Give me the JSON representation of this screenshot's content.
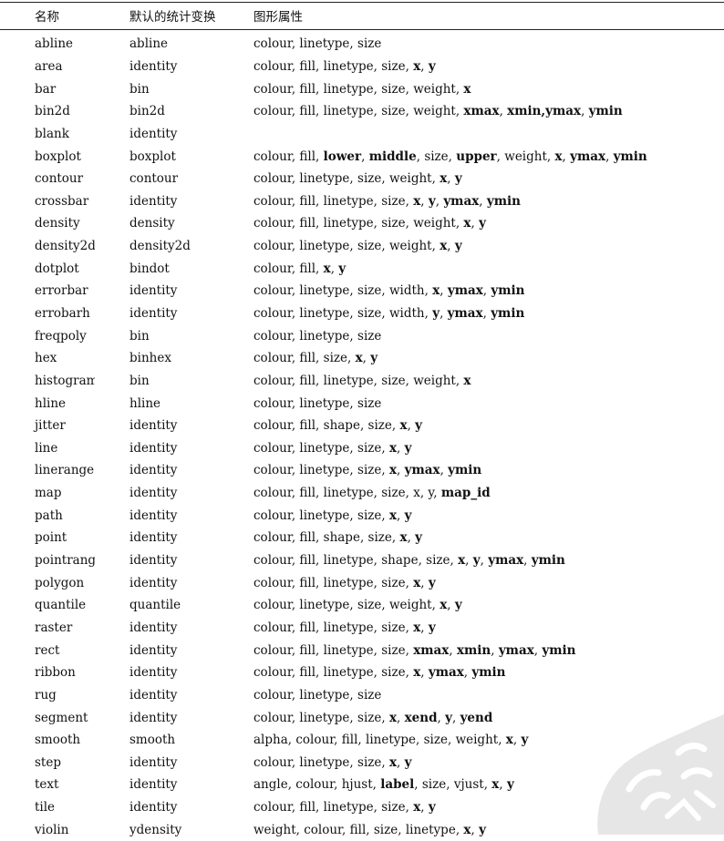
{
  "headers": {
    "name": "名称",
    "stat": "默认的统计变换",
    "aes": "图形属性"
  },
  "rows": [
    {
      "name": "abline",
      "stat": "abline",
      "aes": [
        {
          "t": "colour",
          "b": false
        },
        {
          "t": "linetype",
          "b": false
        },
        {
          "t": "size",
          "b": false
        }
      ]
    },
    {
      "name": "area",
      "stat": "identity",
      "aes": [
        {
          "t": "colour",
          "b": false
        },
        {
          "t": "fill",
          "b": false
        },
        {
          "t": "linetype",
          "b": false
        },
        {
          "t": "size",
          "b": false
        },
        {
          "t": "x",
          "b": true
        },
        {
          "t": "y",
          "b": true
        }
      ]
    },
    {
      "name": "bar",
      "stat": "bin",
      "aes": [
        {
          "t": "colour",
          "b": false
        },
        {
          "t": "fill",
          "b": false
        },
        {
          "t": "linetype",
          "b": false
        },
        {
          "t": "size",
          "b": false
        },
        {
          "t": "weight",
          "b": false
        },
        {
          "t": "x",
          "b": true
        }
      ]
    },
    {
      "name": "bin2d",
      "stat": "bin2d",
      "aes": [
        {
          "t": "colour",
          "b": false
        },
        {
          "t": "fill",
          "b": false
        },
        {
          "t": "linetype",
          "b": false
        },
        {
          "t": "size",
          "b": false
        },
        {
          "t": "weight",
          "b": false
        },
        {
          "t": "xmax",
          "b": true
        },
        {
          "t": "xmin,ymax",
          "b": true
        },
        {
          "t": "ymin",
          "b": true
        }
      ]
    },
    {
      "name": "blank",
      "stat": "identity",
      "aes": []
    },
    {
      "name": "boxplot",
      "stat": "boxplot",
      "aes": [
        {
          "t": "colour",
          "b": false
        },
        {
          "t": "fill",
          "b": false
        },
        {
          "t": "lower",
          "b": true
        },
        {
          "t": "middle",
          "b": true
        },
        {
          "t": "size",
          "b": false
        },
        {
          "t": "upper",
          "b": true
        },
        {
          "t": "weight",
          "b": false
        },
        {
          "t": "x",
          "b": true
        },
        {
          "t": "ymax",
          "b": true
        },
        {
          "t": "ymin",
          "b": true
        }
      ]
    },
    {
      "name": "contour",
      "stat": "contour",
      "aes": [
        {
          "t": "colour",
          "b": false
        },
        {
          "t": "linetype",
          "b": false
        },
        {
          "t": "size",
          "b": false
        },
        {
          "t": "weight",
          "b": false
        },
        {
          "t": "x",
          "b": true
        },
        {
          "t": "y",
          "b": true
        }
      ]
    },
    {
      "name": "crossbar",
      "stat": "identity",
      "aes": [
        {
          "t": "colour",
          "b": false
        },
        {
          "t": "fill",
          "b": false
        },
        {
          "t": "linetype",
          "b": false
        },
        {
          "t": "size",
          "b": false
        },
        {
          "t": "x",
          "b": true
        },
        {
          "t": "y",
          "b": true
        },
        {
          "t": "ymax",
          "b": true
        },
        {
          "t": "ymin",
          "b": true
        }
      ]
    },
    {
      "name": "density",
      "stat": "density",
      "aes": [
        {
          "t": "colour",
          "b": false
        },
        {
          "t": "fill",
          "b": false
        },
        {
          "t": "linetype",
          "b": false
        },
        {
          "t": "size",
          "b": false
        },
        {
          "t": "weight",
          "b": false
        },
        {
          "t": "x",
          "b": true
        },
        {
          "t": "y",
          "b": true
        }
      ]
    },
    {
      "name": "density2d",
      "stat": "density2d",
      "aes": [
        {
          "t": "colour",
          "b": false
        },
        {
          "t": "linetype",
          "b": false
        },
        {
          "t": "size",
          "b": false
        },
        {
          "t": "weight",
          "b": false
        },
        {
          "t": "x",
          "b": true
        },
        {
          "t": "y",
          "b": true
        }
      ]
    },
    {
      "name": "dotplot",
      "stat": "bindot",
      "aes": [
        {
          "t": "colour",
          "b": false
        },
        {
          "t": "fill",
          "b": false
        },
        {
          "t": "x",
          "b": true
        },
        {
          "t": "y",
          "b": true
        }
      ]
    },
    {
      "name": "errorbar",
      "stat": "identity",
      "aes": [
        {
          "t": "colour",
          "b": false
        },
        {
          "t": "linetype",
          "b": false
        },
        {
          "t": "size",
          "b": false
        },
        {
          "t": "width",
          "b": false
        },
        {
          "t": "x",
          "b": true
        },
        {
          "t": "ymax",
          "b": true
        },
        {
          "t": "ymin",
          "b": true
        }
      ]
    },
    {
      "name": "errobarh",
      "stat": "identity",
      "aes": [
        {
          "t": "colour",
          "b": false
        },
        {
          "t": "linetype",
          "b": false
        },
        {
          "t": "size",
          "b": false
        },
        {
          "t": "width",
          "b": false
        },
        {
          "t": "y",
          "b": true
        },
        {
          "t": "ymax",
          "b": true
        },
        {
          "t": "ymin",
          "b": true
        }
      ]
    },
    {
      "name": "freqpoly",
      "stat": "bin",
      "aes": [
        {
          "t": "colour",
          "b": false
        },
        {
          "t": "linetype",
          "b": false
        },
        {
          "t": "size",
          "b": false
        }
      ]
    },
    {
      "name": "hex",
      "stat": "binhex",
      "aes": [
        {
          "t": "colour",
          "b": false
        },
        {
          "t": "fill",
          "b": false
        },
        {
          "t": "size",
          "b": false
        },
        {
          "t": "x",
          "b": true
        },
        {
          "t": "y",
          "b": true
        }
      ]
    },
    {
      "name": "histogram",
      "stat": "bin",
      "aes": [
        {
          "t": "colour",
          "b": false
        },
        {
          "t": "fill",
          "b": false
        },
        {
          "t": "linetype",
          "b": false
        },
        {
          "t": "size",
          "b": false
        },
        {
          "t": "weight",
          "b": false
        },
        {
          "t": "x",
          "b": true
        }
      ]
    },
    {
      "name": "hline",
      "stat": "hline",
      "aes": [
        {
          "t": "colour",
          "b": false
        },
        {
          "t": "linetype",
          "b": false
        },
        {
          "t": "size",
          "b": false
        }
      ]
    },
    {
      "name": "jitter",
      "stat": "identity",
      "aes": [
        {
          "t": "colour",
          "b": false
        },
        {
          "t": "fill",
          "b": false
        },
        {
          "t": "shape",
          "b": false
        },
        {
          "t": "size",
          "b": false
        },
        {
          "t": "x",
          "b": true
        },
        {
          "t": "y",
          "b": true
        }
      ]
    },
    {
      "name": "line",
      "stat": "identity",
      "aes": [
        {
          "t": "colour",
          "b": false
        },
        {
          "t": "linetype",
          "b": false
        },
        {
          "t": "size",
          "b": false
        },
        {
          "t": "x",
          "b": true
        },
        {
          "t": "y",
          "b": true
        }
      ]
    },
    {
      "name": "linerange",
      "stat": "identity",
      "aes": [
        {
          "t": "colour",
          "b": false
        },
        {
          "t": "linetype",
          "b": false
        },
        {
          "t": "size",
          "b": false
        },
        {
          "t": "x",
          "b": true
        },
        {
          "t": "ymax",
          "b": true
        },
        {
          "t": "ymin",
          "b": true
        }
      ]
    },
    {
      "name": "map",
      "stat": "identity",
      "aes": [
        {
          "t": "colour",
          "b": false
        },
        {
          "t": "fill",
          "b": false
        },
        {
          "t": "linetype",
          "b": false
        },
        {
          "t": "size",
          "b": false
        },
        {
          "t": "x",
          "b": false
        },
        {
          "t": "y",
          "b": false
        },
        {
          "t": "map_id",
          "b": true
        }
      ]
    },
    {
      "name": "path",
      "stat": "identity",
      "aes": [
        {
          "t": "colour",
          "b": false
        },
        {
          "t": "linetype",
          "b": false
        },
        {
          "t": "size",
          "b": false
        },
        {
          "t": "x",
          "b": true
        },
        {
          "t": "y",
          "b": true
        }
      ]
    },
    {
      "name": "point",
      "stat": "identity",
      "aes": [
        {
          "t": "colour",
          "b": false
        },
        {
          "t": "fill",
          "b": false
        },
        {
          "t": "shape",
          "b": false
        },
        {
          "t": "size",
          "b": false
        },
        {
          "t": "x",
          "b": true
        },
        {
          "t": "y",
          "b": true
        }
      ]
    },
    {
      "name": "pointrange",
      "stat": "identity",
      "aes": [
        {
          "t": "colour",
          "b": false
        },
        {
          "t": "fill",
          "b": false
        },
        {
          "t": "linetype",
          "b": false
        },
        {
          "t": "shape",
          "b": false
        },
        {
          "t": "size",
          "b": false
        },
        {
          "t": "x",
          "b": true
        },
        {
          "t": "y",
          "b": true
        },
        {
          "t": "ymax",
          "b": true
        },
        {
          "t": "ymin",
          "b": true
        }
      ]
    },
    {
      "name": "polygon",
      "stat": "identity",
      "aes": [
        {
          "t": "colour",
          "b": false
        },
        {
          "t": "fill",
          "b": false
        },
        {
          "t": "linetype",
          "b": false
        },
        {
          "t": "size",
          "b": false
        },
        {
          "t": "x",
          "b": true
        },
        {
          "t": "y",
          "b": true
        }
      ]
    },
    {
      "name": "quantile",
      "stat": "quantile",
      "aes": [
        {
          "t": "colour",
          "b": false
        },
        {
          "t": "linetype",
          "b": false
        },
        {
          "t": "size",
          "b": false
        },
        {
          "t": "weight",
          "b": false
        },
        {
          "t": "x",
          "b": true
        },
        {
          "t": "y",
          "b": true
        }
      ]
    },
    {
      "name": "raster",
      "stat": "identity",
      "aes": [
        {
          "t": "colour",
          "b": false
        },
        {
          "t": "fill",
          "b": false
        },
        {
          "t": "linetype",
          "b": false
        },
        {
          "t": "size",
          "b": false
        },
        {
          "t": "x",
          "b": true
        },
        {
          "t": "y",
          "b": true
        }
      ]
    },
    {
      "name": "rect",
      "stat": "identity",
      "aes": [
        {
          "t": "colour",
          "b": false
        },
        {
          "t": "fill",
          "b": false
        },
        {
          "t": "linetype",
          "b": false
        },
        {
          "t": "size",
          "b": false
        },
        {
          "t": "xmax",
          "b": true
        },
        {
          "t": "xmin",
          "b": true
        },
        {
          "t": "ymax",
          "b": true
        },
        {
          "t": "ymin",
          "b": true
        }
      ]
    },
    {
      "name": "ribbon",
      "stat": "identity",
      "aes": [
        {
          "t": "colour",
          "b": false
        },
        {
          "t": "fill",
          "b": false
        },
        {
          "t": "linetype",
          "b": false
        },
        {
          "t": "size",
          "b": false
        },
        {
          "t": "x",
          "b": true
        },
        {
          "t": "ymax",
          "b": true
        },
        {
          "t": "ymin",
          "b": true
        }
      ]
    },
    {
      "name": "rug",
      "stat": "identity",
      "aes": [
        {
          "t": "colour",
          "b": false
        },
        {
          "t": "linetype",
          "b": false
        },
        {
          "t": "size",
          "b": false
        }
      ]
    },
    {
      "name": "segment",
      "stat": "identity",
      "aes": [
        {
          "t": "colour",
          "b": false
        },
        {
          "t": "linetype",
          "b": false
        },
        {
          "t": "size",
          "b": false
        },
        {
          "t": "x",
          "b": true
        },
        {
          "t": "xend",
          "b": true
        },
        {
          "t": "y",
          "b": true
        },
        {
          "t": "yend",
          "b": true
        }
      ]
    },
    {
      "name": "smooth",
      "stat": "smooth",
      "aes": [
        {
          "t": "alpha",
          "b": false
        },
        {
          "t": "colour",
          "b": false
        },
        {
          "t": "fill",
          "b": false
        },
        {
          "t": "linetype",
          "b": false
        },
        {
          "t": "size",
          "b": false
        },
        {
          "t": "weight",
          "b": false
        },
        {
          "t": "x",
          "b": true
        },
        {
          "t": "y",
          "b": true
        }
      ]
    },
    {
      "name": "step",
      "stat": "identity",
      "aes": [
        {
          "t": "colour",
          "b": false
        },
        {
          "t": "linetype",
          "b": false
        },
        {
          "t": "size",
          "b": false
        },
        {
          "t": "x",
          "b": true
        },
        {
          "t": "y",
          "b": true
        }
      ]
    },
    {
      "name": "text",
      "stat": "identity",
      "aes": [
        {
          "t": "angle",
          "b": false
        },
        {
          "t": "colour",
          "b": false
        },
        {
          "t": "hjust",
          "b": false
        },
        {
          "t": "label",
          "b": true
        },
        {
          "t": "size",
          "b": false
        },
        {
          "t": "vjust",
          "b": false
        },
        {
          "t": "x",
          "b": true
        },
        {
          "t": "y",
          "b": true
        }
      ]
    },
    {
      "name": "tile",
      "stat": "identity",
      "aes": [
        {
          "t": "colour",
          "b": false
        },
        {
          "t": "fill",
          "b": false
        },
        {
          "t": "linetype",
          "b": false
        },
        {
          "t": "size",
          "b": false
        },
        {
          "t": "x",
          "b": true
        },
        {
          "t": "y",
          "b": true
        }
      ]
    },
    {
      "name": "violin",
      "stat": "ydensity",
      "aes": [
        {
          "t": "weight",
          "b": false
        },
        {
          "t": "colour",
          "b": false
        },
        {
          "t": "fill",
          "b": false
        },
        {
          "t": "size",
          "b": false
        },
        {
          "t": "linetype",
          "b": false
        },
        {
          "t": "x",
          "b": true
        },
        {
          "t": "y",
          "b": true
        }
      ]
    }
  ]
}
